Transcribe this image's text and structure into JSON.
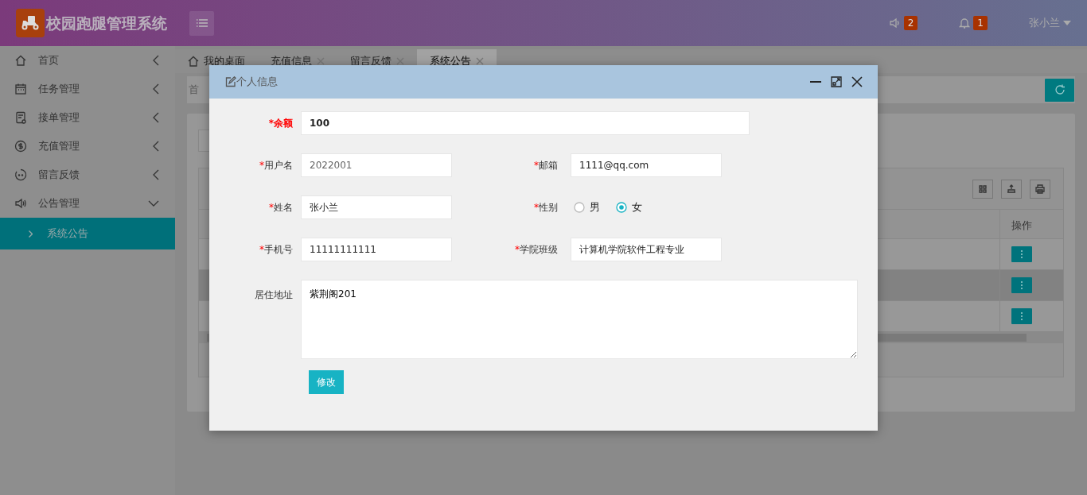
{
  "app": {
    "title": "校园跑腿管理系统",
    "notices": "2",
    "alerts": "1",
    "user": "张小兰"
  },
  "sidebar": {
    "items": [
      {
        "label": "首页",
        "expanded": false
      },
      {
        "label": "任务管理",
        "expanded": false
      },
      {
        "label": "接单管理",
        "expanded": false
      },
      {
        "label": "充值管理",
        "expanded": false
      },
      {
        "label": "留言反馈",
        "expanded": false
      },
      {
        "label": "公告管理",
        "expanded": true,
        "children": [
          {
            "label": "系统公告",
            "selected": true
          }
        ]
      }
    ]
  },
  "tabs": [
    {
      "label": "我的桌面",
      "closable": false,
      "selected": false
    },
    {
      "label": "充值信息",
      "closable": true,
      "selected": false
    },
    {
      "label": "留言反馈",
      "closable": true,
      "selected": false
    },
    {
      "label": "系统公告",
      "closable": true,
      "selected": true
    }
  ],
  "breadcrumb": "首",
  "table": {
    "columns": [
      "操作"
    ],
    "rows": [
      {
        "selected": false
      },
      {
        "selected": true
      },
      {
        "selected": false
      }
    ]
  },
  "modal": {
    "title": "个人信息",
    "fields": [
      {
        "kind": "text",
        "marker": "*",
        "label": "余额",
        "highlighted": true,
        "value": "100",
        "wide": true
      },
      {
        "kind": "text",
        "marker": "*",
        "label": "用户名",
        "highlighted": false,
        "value": "2022001",
        "wide": false,
        "disabled": true
      },
      {
        "kind": "text",
        "marker": "*",
        "label": "邮箱",
        "highlighted": false,
        "value": "1111@qq.com",
        "wide": false,
        "disabled": false
      },
      {
        "kind": "text",
        "marker": "*",
        "label": "姓名",
        "highlighted": false,
        "value": "张小兰",
        "wide": false,
        "disabled": false
      },
      {
        "kind": "radio",
        "marker": "*",
        "label": "性别",
        "highlighted": false,
        "options": [
          {
            "label": "男",
            "selected": false
          },
          {
            "label": "女",
            "selected": true
          }
        ]
      },
      {
        "kind": "text",
        "marker": "*",
        "label": "手机号",
        "highlighted": false,
        "value": "11111111111",
        "wide": false,
        "disabled": false
      },
      {
        "kind": "text",
        "marker": "*",
        "label": "学院班级",
        "highlighted": false,
        "value": "计算机学院软件工程专业",
        "wide": false,
        "disabled": false
      },
      {
        "kind": "textarea",
        "label": "居住地址",
        "highlighted": false,
        "value": "紫荆阁201"
      }
    ],
    "submit": "修改"
  }
}
